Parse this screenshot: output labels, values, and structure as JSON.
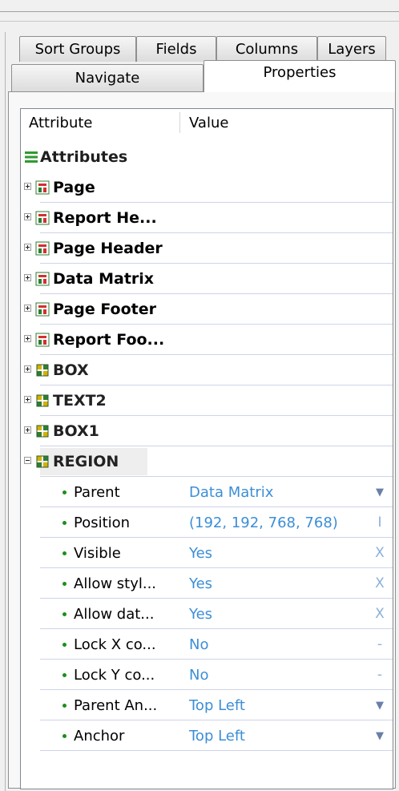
{
  "tabs_row1": [
    {
      "label": "Sort Groups"
    },
    {
      "label": "Fields"
    },
    {
      "label": "Columns"
    },
    {
      "label": "Layers"
    }
  ],
  "tabs_row2": [
    {
      "label": "Navigate"
    },
    {
      "label": "Properties",
      "active": true
    }
  ],
  "grid": {
    "col_attribute": "Attribute",
    "col_value": "Value"
  },
  "tree": {
    "root": {
      "label": "Attributes",
      "icon": "attributes-list-icon"
    },
    "sections": [
      {
        "label": "Page",
        "icon": "section-icon"
      },
      {
        "label": "Report He...",
        "icon": "section-icon"
      },
      {
        "label": "Page Header",
        "icon": "section-icon"
      },
      {
        "label": "Data Matrix",
        "icon": "section-icon"
      },
      {
        "label": "Page Footer",
        "icon": "section-icon"
      },
      {
        "label": "Report Foo...",
        "icon": "section-icon"
      }
    ],
    "objects": [
      {
        "label": "BOX",
        "icon": "object-icon"
      },
      {
        "label": "TEXT2",
        "icon": "object-icon"
      },
      {
        "label": "BOX1",
        "icon": "object-icon"
      }
    ],
    "expanded": {
      "label": "REGION",
      "icon": "object-icon"
    },
    "properties": [
      {
        "name": "Parent",
        "value": "Data Matrix",
        "action": "▼",
        "action_icon": "dropdown-arrow-icon"
      },
      {
        "name": "Position",
        "value": "(192, 192, 768, 768)",
        "action": "I",
        "action_icon": "text-cursor-icon"
      },
      {
        "name": "Visible",
        "value": "Yes",
        "action": "X",
        "action_icon": "toggle-x-icon"
      },
      {
        "name": "Allow styl...",
        "value": "Yes",
        "action": "X",
        "action_icon": "toggle-x-icon"
      },
      {
        "name": "Allow dat...",
        "value": "Yes",
        "action": "X",
        "action_icon": "toggle-x-icon"
      },
      {
        "name": "Lock X co...",
        "value": "No",
        "action": "-",
        "action_icon": "toggle-dash-icon"
      },
      {
        "name": "Lock Y co...",
        "value": "No",
        "action": "-",
        "action_icon": "toggle-dash-icon"
      },
      {
        "name": "Parent An...",
        "value": "Top Left",
        "action": "▼",
        "action_icon": "dropdown-arrow-icon"
      },
      {
        "name": "Anchor",
        "value": "Top Left",
        "action": "▼",
        "action_icon": "dropdown-arrow-icon"
      }
    ]
  },
  "colors": {
    "value_text": "#3c8ed6",
    "bullet": "#1b8f1b",
    "grid_line": "#cfd3e8"
  }
}
